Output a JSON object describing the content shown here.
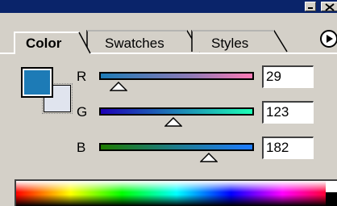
{
  "titlebar": {
    "minimize_icon": "minimize-icon",
    "close_icon": "close-icon"
  },
  "tabs": [
    {
      "label": "Color",
      "active": true
    },
    {
      "label": "Swatches",
      "active": false
    },
    {
      "label": "Styles",
      "active": false
    }
  ],
  "menu_icon": "triangle-right-icon",
  "colors": {
    "foreground": "#1d7bb6",
    "background": "#e0e4ee",
    "panel": "#d4d0c8",
    "titlebar": "#0a246a"
  },
  "channels": [
    {
      "label": "R",
      "value": "29"
    },
    {
      "label": "G",
      "value": "123"
    },
    {
      "label": "B",
      "value": "182"
    }
  ]
}
